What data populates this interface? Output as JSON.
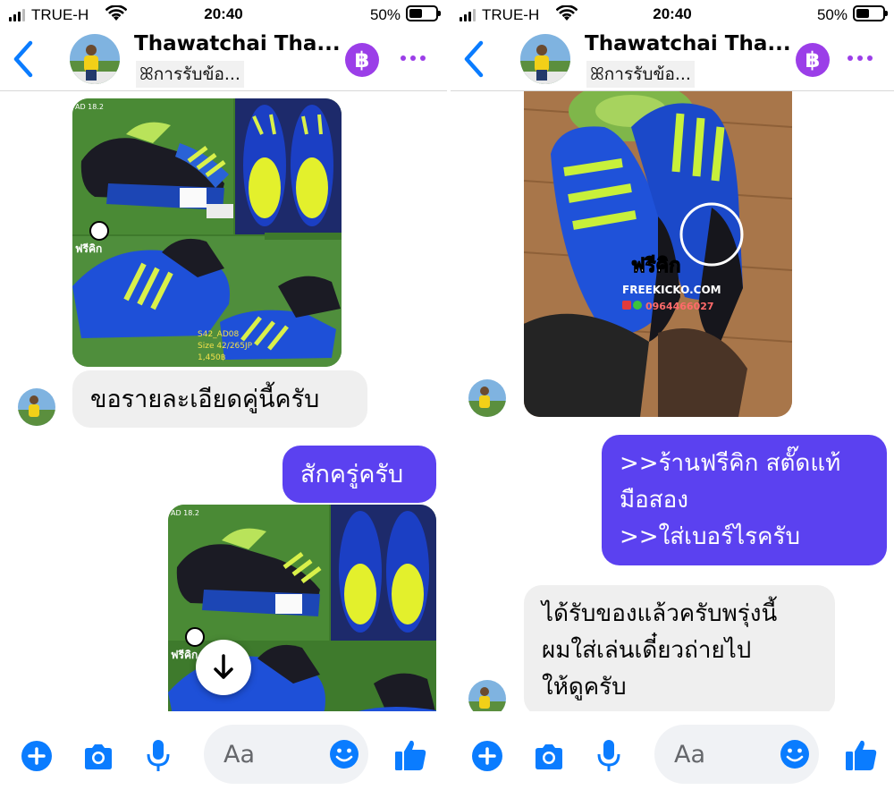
{
  "status_bar": {
    "carrier": "TRUE-H",
    "time": "20:40",
    "battery_percent": "50%"
  },
  "header": {
    "contact_name": "Thawatchai Tha...",
    "subtitle": "ꕤการรับข้อ...",
    "badge_symbol": "฿"
  },
  "left_chat": {
    "message_received_1": "ขอรายละเอียดคู่นี้ครับ",
    "message_sent_1": "สักครู่ครับ",
    "photo_1_corner_text": "AD 18.2",
    "photo_1_brand_text": "ฟรีคิก",
    "photo_1_caption_lines": [
      "S42_AD08",
      "Size 42/265JP",
      "1,450฿"
    ],
    "photo_2_corner_text": "AD 18.2",
    "photo_2_brand_text": "ฟรีคิก"
  },
  "right_chat": {
    "watermark_brand": "ฟรีคิก",
    "watermark_site": "FREEKICKO.COM",
    "watermark_phone": "0964466027",
    "message_sent_1": ">>ร้านฟรีคิก สตั๊ดแท้\nมือสอง\n>>ใส่เบอร์ไรครับ",
    "message_received_1": "ได้รับของแล้วครับพรุ่งนี้\nผมใส่เล่นเดี๋ยวถ่ายไป\nให้ดูครับ"
  },
  "composer": {
    "placeholder": "Aa"
  },
  "colors": {
    "accent_blue": "#0a7cff",
    "sent_bubble": "#5b41f0",
    "received_bubble": "#efefef",
    "badge_purple": "#9b3ee8"
  },
  "icons": [
    "back-chevron-icon",
    "bitcoin-badge-icon",
    "more-dots-icon",
    "plus-icon",
    "camera-icon",
    "mic-icon",
    "emoji-icon",
    "thumbs-up-icon",
    "down-arrow-icon",
    "wifi-icon",
    "battery-icon",
    "signal-icon"
  ]
}
